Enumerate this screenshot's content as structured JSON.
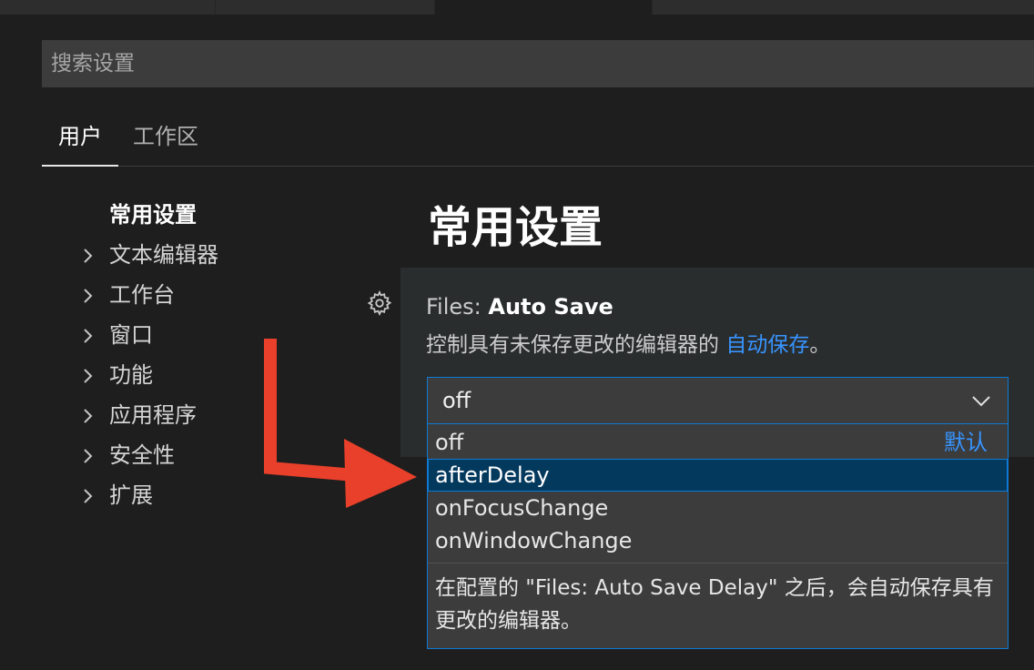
{
  "colors": {
    "background": "#1e1e1e",
    "panel": "#2a2d2e",
    "input": "#3c3c3c",
    "focus_border": "#0e7ad3",
    "selected_option": "#04395e",
    "link": "#3794ff",
    "annotation_arrow": "#e8402a"
  },
  "search": {
    "placeholder": "搜索设置"
  },
  "scope_tabs": [
    {
      "label": "用户",
      "active": true
    },
    {
      "label": "工作区",
      "active": false
    }
  ],
  "toc": {
    "items": [
      {
        "label": "常用设置",
        "expandable": false,
        "active": true
      },
      {
        "label": "文本编辑器",
        "expandable": true
      },
      {
        "label": "工作台",
        "expandable": true
      },
      {
        "label": "窗口",
        "expandable": true
      },
      {
        "label": "功能",
        "expandable": true
      },
      {
        "label": "应用程序",
        "expandable": true
      },
      {
        "label": "安全性",
        "expandable": true
      },
      {
        "label": "扩展",
        "expandable": true
      }
    ]
  },
  "section": {
    "title": "常用设置"
  },
  "setting": {
    "category": "Files: ",
    "name": "Auto Save",
    "description_prefix": "控制具有未保存更改的编辑器的 ",
    "description_link": "自动保存",
    "description_suffix": "。",
    "gear_icon": "gear-icon",
    "current_value": "off",
    "options": [
      {
        "label": "off",
        "tag": "默认",
        "selected": false
      },
      {
        "label": "afterDelay",
        "tag": "",
        "selected": true
      },
      {
        "label": "onFocusChange",
        "tag": "",
        "selected": false
      },
      {
        "label": "onWindowChange",
        "tag": "",
        "selected": false
      }
    ],
    "option_description": "在配置的 \"Files: Auto Save Delay\" 之后，会自动保存具有更改的编辑器。"
  }
}
